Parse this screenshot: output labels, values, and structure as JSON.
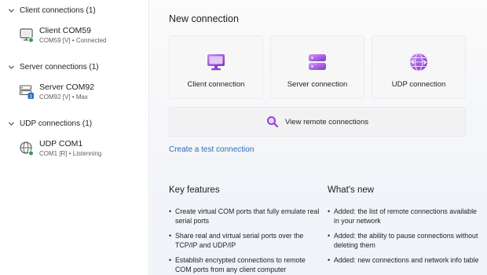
{
  "sidebar": {
    "groups": [
      {
        "label": "Client connections (1)",
        "items": [
          {
            "name": "Client COM59",
            "sub": "COM59 [V] • Connected",
            "icon": "client-connection-icon",
            "status": "green"
          }
        ]
      },
      {
        "label": "Server connections (1)",
        "items": [
          {
            "name": "Server COM92",
            "sub": "COM92 [V] • Max",
            "icon": "server-connection-icon",
            "status": "blue-1"
          }
        ]
      },
      {
        "label": "UDP connections (1)",
        "items": [
          {
            "name": "UDP COM1",
            "sub": "COM1 [R] • Listenning",
            "icon": "udp-connection-icon",
            "status": "green"
          }
        ]
      }
    ]
  },
  "main": {
    "title": "New connection",
    "cards": [
      {
        "label": "Client connection",
        "icon": "monitor-icon"
      },
      {
        "label": "Server connection",
        "icon": "server-stack-icon"
      },
      {
        "label": "UDP connection",
        "icon": "globe-arrows-icon"
      }
    ],
    "remote": {
      "label": "View remote connections",
      "icon": "magnifier-icon"
    },
    "test_link": "Create a test connection",
    "features": {
      "title": "Key features",
      "items": [
        "Create virtual COM ports that fully emulate real serial ports",
        "Share real and virtual serial ports over the TCP/IP and UDP/IP",
        "Establish encrypted connections to remote COM ports from any client computer"
      ]
    },
    "whatsnew": {
      "title": "What's new",
      "items": [
        "Added: the list of remote connections available in your network",
        "Added: the ability to pause connections without deleting them",
        "Added: new connections and network info table"
      ]
    }
  },
  "colors": {
    "accent_purple": "#8a3fd6",
    "link_blue": "#2a6fb8",
    "status_green": "#2ea043",
    "status_blue": "#2f6fd6"
  }
}
